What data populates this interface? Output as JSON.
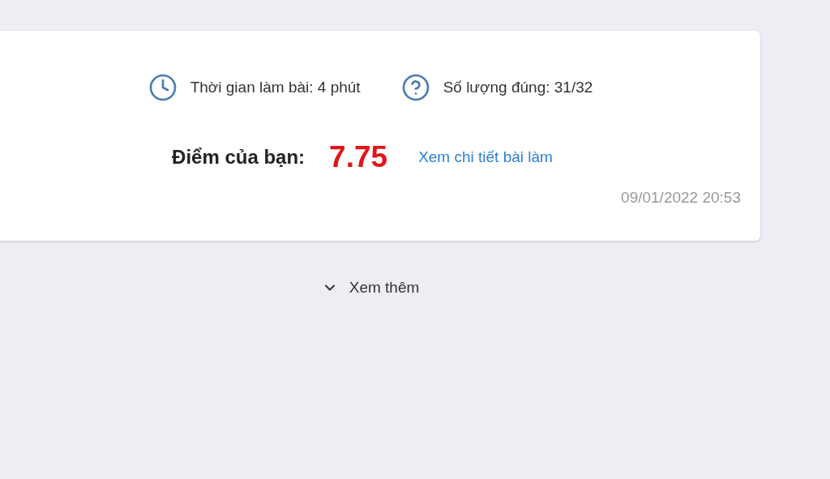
{
  "result_card": {
    "stats": [
      {
        "kind": "time",
        "text": "Thời gian làm bài: 4 phút"
      },
      {
        "kind": "correct",
        "text": "Số lượng đúng: 31/32"
      }
    ],
    "score_label": "Điểm của bạn:",
    "score": "7.75",
    "detail_link": "Xem chi tiết bài làm",
    "timestamp": "09/01/2022 20:53"
  },
  "show_more": "Xem thêm"
}
